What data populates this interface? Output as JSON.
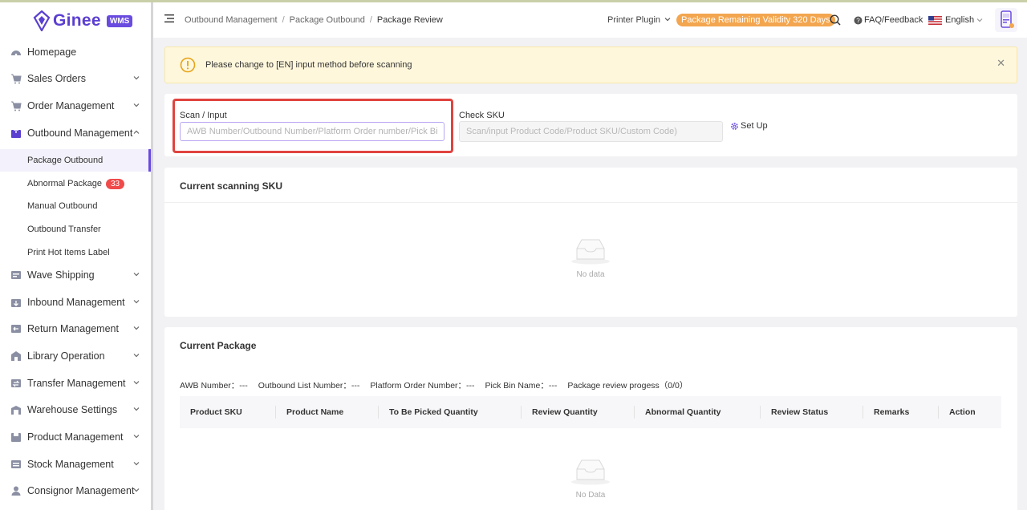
{
  "brand": {
    "name": "Ginee",
    "badge": "WMS"
  },
  "sidebar": {
    "items": [
      {
        "label": "Homepage",
        "icon": "dashboard-icon",
        "expandable": false
      },
      {
        "label": "Sales Orders",
        "icon": "cart-icon",
        "expandable": true
      },
      {
        "label": "Order Management",
        "icon": "cart-icon",
        "expandable": true
      },
      {
        "label": "Outbound Management",
        "icon": "outbound-box-icon",
        "expandable": true,
        "expanded": true
      },
      {
        "label": "Wave Shipping",
        "icon": "wave-icon",
        "expandable": true
      },
      {
        "label": "Inbound Management",
        "icon": "inbound-icon",
        "expandable": true
      },
      {
        "label": "Return Management",
        "icon": "return-icon",
        "expandable": true
      },
      {
        "label": "Library Operation",
        "icon": "library-icon",
        "expandable": true
      },
      {
        "label": "Transfer Management",
        "icon": "transfer-icon",
        "expandable": true
      },
      {
        "label": "Warehouse Settings",
        "icon": "warehouse-icon",
        "expandable": true
      },
      {
        "label": "Product Management",
        "icon": "product-icon",
        "expandable": true
      },
      {
        "label": "Stock Management",
        "icon": "stock-icon",
        "expandable": true
      },
      {
        "label": "Consignor Management",
        "icon": "person-icon",
        "expandable": true
      }
    ],
    "sub_items": [
      {
        "label": "Package Outbound",
        "active": true
      },
      {
        "label": "Abnormal Package",
        "badge": "33"
      },
      {
        "label": "Manual Outbound"
      },
      {
        "label": "Outbound Transfer"
      },
      {
        "label": "Print Hot Items Label"
      }
    ]
  },
  "header": {
    "breadcrumb": [
      "Outbound Management",
      "Package Outbound",
      "Package Review"
    ],
    "printer_plugin": "Printer Plugin",
    "validity": "Package Remaining Validity 320 Days",
    "faq": "FAQ/Feedback",
    "language": "English"
  },
  "alert": {
    "text": "Please change to [EN] input method before scanning",
    "close": "✕"
  },
  "scan": {
    "label": "Scan / Input",
    "placeholder": "AWB Number/Outbound Number/Platform Order number/Pick Bin Barcode",
    "check_label": "Check SKU",
    "check_placeholder": "Scan/input Product Code/Product SKU/Custom Code)",
    "setup": "Set Up"
  },
  "scanning_sku": {
    "title": "Current scanning SKU",
    "empty": "No data"
  },
  "package": {
    "title": "Current Package",
    "info": [
      "AWB Number：---",
      "Outbound List Number：---",
      "Platform Order Number：---",
      "Pick Bin Name：---",
      "Package review progess（0/0）"
    ],
    "columns": [
      "Product SKU",
      "Product Name",
      "To Be Picked Quantity",
      "Review Quantity",
      "Abnormal Quantity",
      "Review Status",
      "Remarks",
      "Action"
    ],
    "empty": "No Data"
  },
  "colors": {
    "brand": "#5b3fd1",
    "badge_red": "#f04a4a",
    "validity": "#f3a64f",
    "highlight": "#e0433f"
  }
}
